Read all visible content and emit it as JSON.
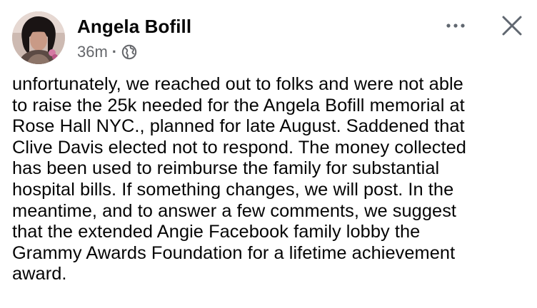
{
  "post": {
    "author": "Angela Bofill",
    "timestamp": "36m",
    "separator": "·",
    "privacy_icon": "globe-icon",
    "more_icon": "more-dots-icon",
    "close_icon": "close-icon",
    "body": "unfortunately, we reached out to folks and were not able\nto raise the 25k needed for the Angela Bofill memorial at\nRose Hall NYC., planned for late August. Saddened that\nClive Davis elected not to respond. The money collected\nhas been used to reimburse the family for substantial\nhospital bills. If something changes, we will post. In the\nmeantime, and to answer a few comments, we suggest\nthat the extended Angie Facebook family lobby the\nGrammy Awards Foundation for a lifetime achievement\naward."
  },
  "colors": {
    "text": "#050505",
    "secondary_text": "#65676b",
    "icon": "#606770",
    "background": "#ffffff"
  }
}
